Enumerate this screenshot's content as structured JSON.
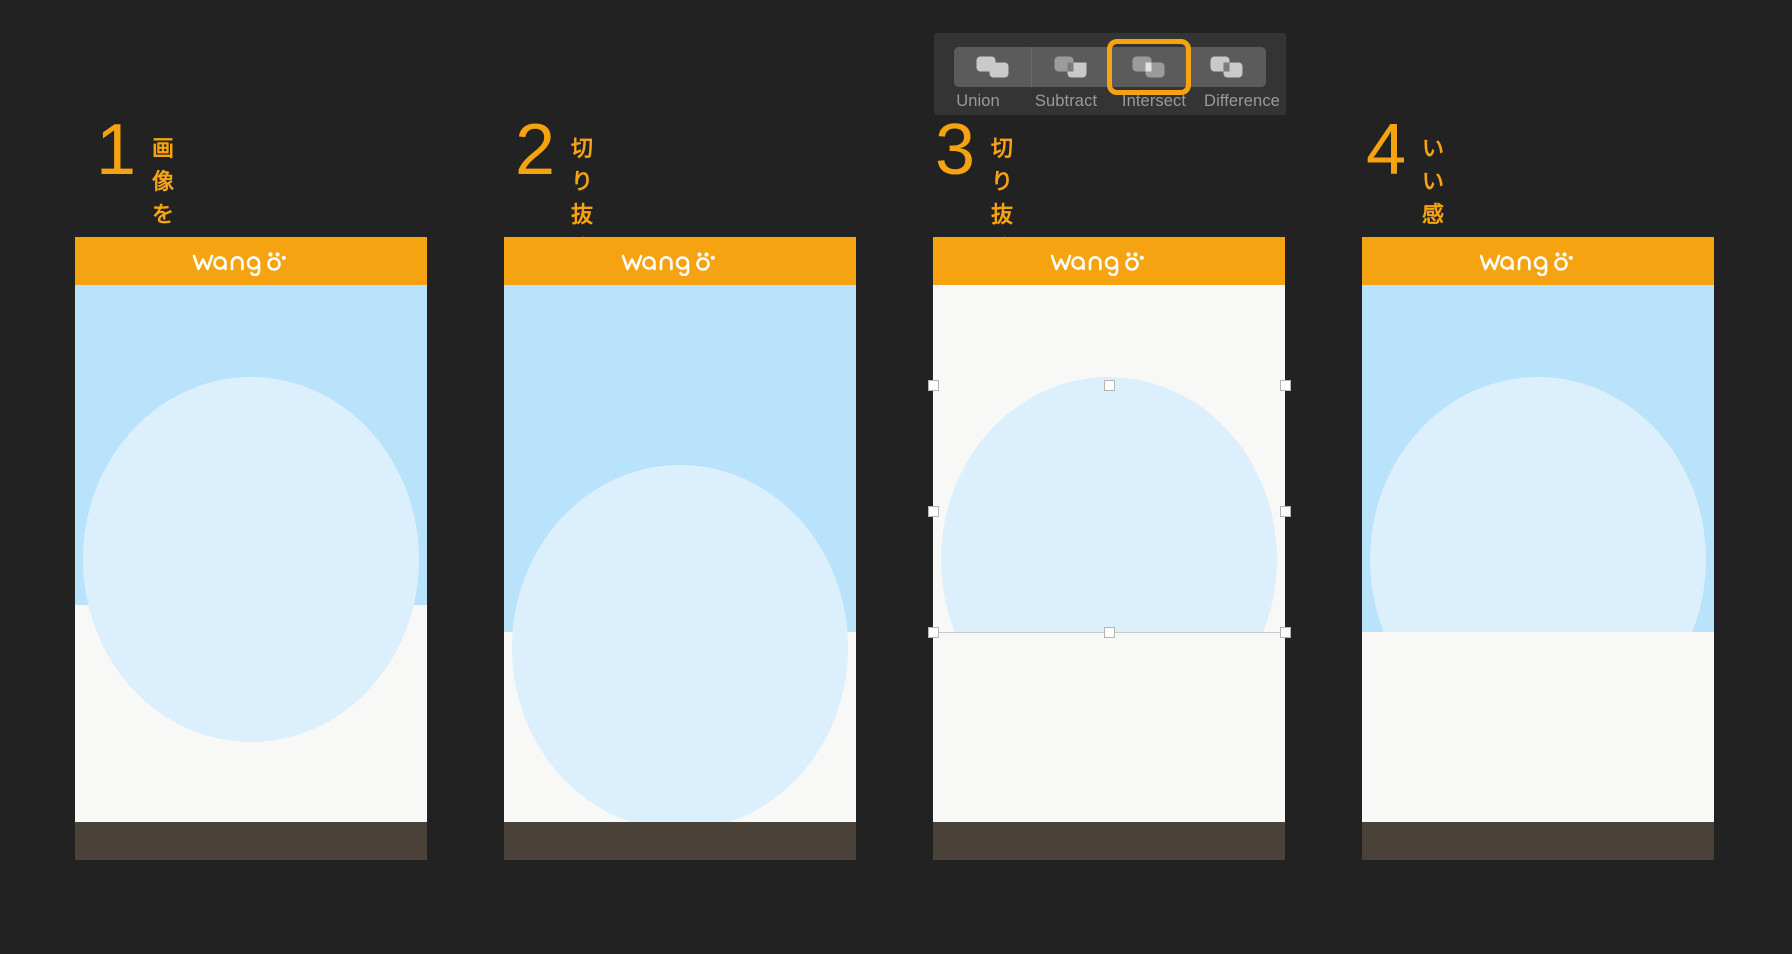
{
  "toolbar": {
    "name": "boolean-operations-toolbar",
    "selected": "Intersect",
    "highlight_color": "#F5A310",
    "buttons": [
      {
        "id": "union",
        "label": "Union",
        "icon": "union-icon"
      },
      {
        "id": "subtract",
        "label": "Subtract",
        "icon": "subtract-icon"
      },
      {
        "id": "intersect",
        "label": "Intersect",
        "icon": "intersect-icon"
      },
      {
        "id": "difference",
        "label": "Difference",
        "icon": "difference-icon"
      }
    ]
  },
  "steps": [
    {
      "number": "1",
      "text": "画像を用意"
    },
    {
      "number": "2",
      "text": "切り抜きたい方の画像\nを下にする"
    },
    {
      "number": "3",
      "text": "切り抜く"
    },
    {
      "number": "4",
      "text": "いい感じに重ねて終了"
    }
  ],
  "cards": [
    {
      "id": "card-1",
      "logo": "wango"
    },
    {
      "id": "card-2",
      "logo": "wango"
    },
    {
      "id": "card-3",
      "logo": "wango"
    },
    {
      "id": "card-4",
      "logo": "wango"
    }
  ],
  "logo": {
    "text": "wango",
    "icon": "paw-print-icon",
    "color": "#FFFFFF"
  },
  "colors": {
    "background": "#222222",
    "accent_orange": "#F5A310",
    "header_orange": "#F5A310",
    "sky_blue": "#B8E3FB",
    "blob_blue": "#DCEFFC",
    "card_white": "#F8F8F7",
    "footer_brown": "#4A4239",
    "toolbar_bg": "#343434",
    "toolbar_button_bg": "#5B5B5B",
    "toolbar_label": "#9A9A9A",
    "handle_fill": "#FFFFFF"
  }
}
